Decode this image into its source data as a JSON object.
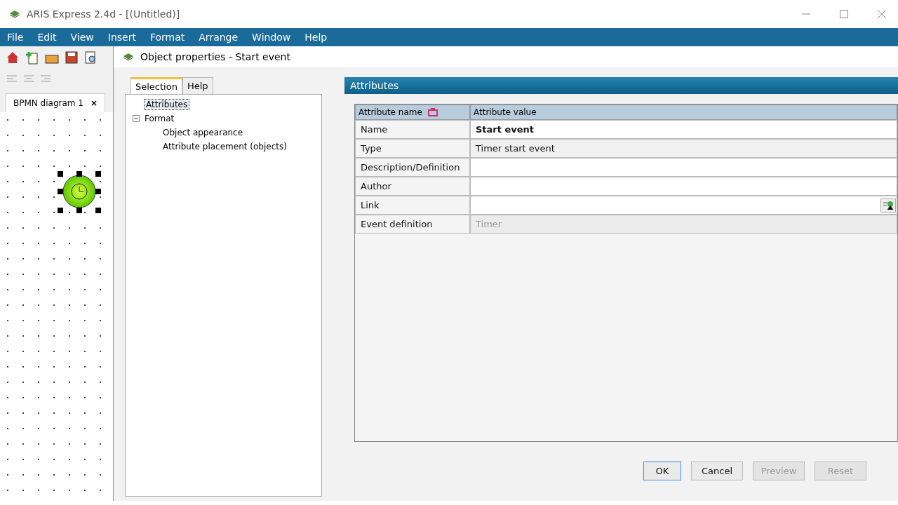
{
  "window": {
    "title": "ARIS Express 2.4d - [(Untitled)]"
  },
  "menu": [
    "File",
    "Edit",
    "View",
    "Insert",
    "Format",
    "Arrange",
    "Window",
    "Help"
  ],
  "diagram_tab": {
    "label": "BPMN diagram 1",
    "close": "×"
  },
  "dialog": {
    "title": "Object properties - Start event",
    "tabs": [
      {
        "label": "Selection",
        "selected": true
      },
      {
        "label": "Help",
        "selected": false
      }
    ],
    "tree": [
      {
        "label": "Attributes",
        "selected": true
      },
      {
        "label": "Format",
        "selected": false,
        "expanded": true,
        "children": [
          {
            "label": "Object appearance",
            "selected": false
          },
          {
            "label": "Attribute placement (objects)",
            "selected": false
          }
        ]
      }
    ],
    "panel_title": "Attributes",
    "table": {
      "columns": [
        "Attribute name",
        "Attribute value"
      ],
      "rows": [
        {
          "name": "Name",
          "value": "Start event",
          "kind": "bold"
        },
        {
          "name": "Type",
          "value": "Timer start event",
          "kind": "readonly"
        },
        {
          "name": "Description/Definition",
          "value": "",
          "kind": "text"
        },
        {
          "name": "Author",
          "value": "",
          "kind": "text"
        },
        {
          "name": "Link",
          "value": "",
          "kind": "link"
        },
        {
          "name": "Event definition",
          "value": "Timer",
          "kind": "disabled"
        }
      ]
    },
    "buttons": [
      {
        "label": "OK",
        "disabled": false,
        "default": true
      },
      {
        "label": "Cancel",
        "disabled": false,
        "default": false
      },
      {
        "label": "Preview",
        "disabled": true,
        "default": false
      },
      {
        "label": "Reset",
        "disabled": true,
        "default": false
      }
    ]
  }
}
